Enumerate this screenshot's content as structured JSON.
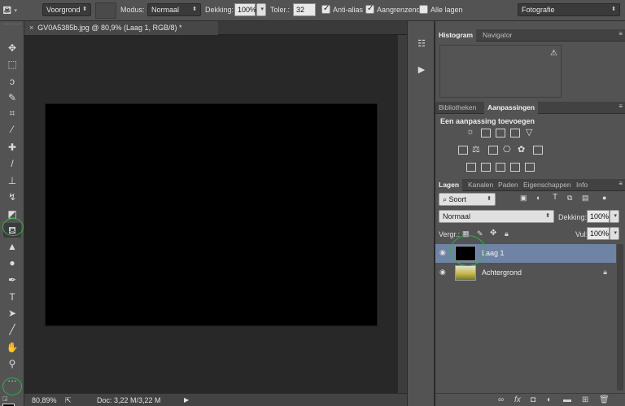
{
  "options_bar": {
    "tool_icon": "paint-bucket-icon",
    "fill_source": "Voorgrond",
    "mode_label": "Modus:",
    "mode_value": "Normaal",
    "opacity_label": "Dekking:",
    "opacity_value": "100%",
    "tolerance_label": "Toler.:",
    "tolerance_value": "32",
    "antialias_label": "Anti-alias",
    "antialias_checked": true,
    "contiguous_label": "Aangrenzend",
    "contiguous_checked": true,
    "all_layers_label": "Alle lagen",
    "all_layers_checked": false,
    "workspace": "Fotografie"
  },
  "document": {
    "tab_title": "GV0A5385b.jpg @ 80,9% (Laag 1, RGB/8) *",
    "close_glyph": "×",
    "canvas_color": "#000000"
  },
  "status_bar": {
    "zoom": "80,89%",
    "doc_info": "Doc: 3,22 M/3,22 M"
  },
  "toolbar": {
    "active_tool": "paint-bucket",
    "foreground_color": "#000000",
    "background_color": "#ffffff"
  },
  "panels": {
    "histogram_tabs": [
      "Histogram",
      "Navigator"
    ],
    "adjustments_tabs": [
      "Bibliotheken",
      "Aanpassingen"
    ],
    "adjustments_title": "Een aanpassing toevoegen",
    "layers_tabs": [
      "Lagen",
      "Kanalen",
      "Paden",
      "Eigenschappen",
      "Info"
    ],
    "filter_kind": "Soort",
    "blend_mode": "Normaal",
    "opacity_label": "Dekking:",
    "opacity_value": "100%",
    "lock_label": "Vergr.:",
    "fill_label": "Vul:",
    "fill_value": "100%",
    "layers": [
      {
        "name": "Laag 1",
        "selected": true,
        "thumb_color": "#000000"
      },
      {
        "name": "Achtergrond",
        "selected": false,
        "locked": true
      }
    ]
  },
  "colors": {
    "highlight_ring": "#2fb04a",
    "selected_layer": "#6f84a4"
  }
}
